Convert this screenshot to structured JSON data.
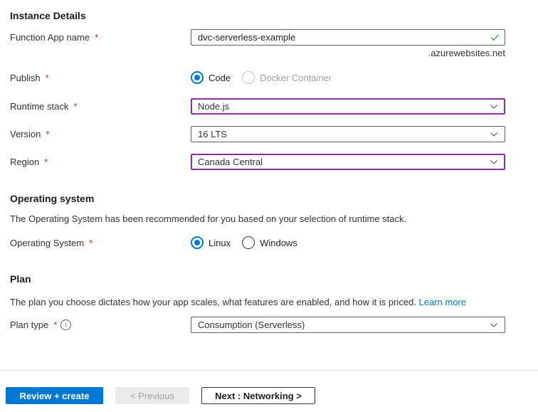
{
  "ui": {
    "required_mark": "*",
    "info_glyph": "i"
  },
  "colors": {
    "accent": "#0078d4",
    "dirty": "#8a2da5",
    "required": "#bc2f32",
    "valid": "#5ba05b"
  },
  "instance_details": {
    "title": "Instance Details",
    "function_app_name": {
      "label": "Function App name",
      "value": "dvc-serverless-example",
      "suffix": ".azurewebsites.net",
      "valid": true
    },
    "publish": {
      "label": "Publish",
      "options": [
        {
          "label": "Code",
          "selected": true,
          "disabled": false
        },
        {
          "label": "Docker Container",
          "selected": false,
          "disabled": true
        }
      ]
    },
    "runtime_stack": {
      "label": "Runtime stack",
      "value": "Node.js",
      "modified": true
    },
    "version": {
      "label": "Version",
      "value": "16 LTS",
      "modified": false
    },
    "region": {
      "label": "Region",
      "value": "Canada Central",
      "modified": true
    }
  },
  "operating_system": {
    "title": "Operating system",
    "description": "The Operating System has been recommended for you based on your selection of runtime stack.",
    "field": {
      "label": "Operating System",
      "options": [
        {
          "label": "Linux",
          "selected": true,
          "disabled": false
        },
        {
          "label": "Windows",
          "selected": false,
          "disabled": false
        }
      ]
    }
  },
  "plan": {
    "title": "Plan",
    "description": "The plan you choose dictates how your app scales, what features are enabled, and how it is priced.",
    "learn_more_label": "Learn more",
    "plan_type": {
      "label": "Plan type",
      "value": "Consumption (Serverless)",
      "modified": false
    }
  },
  "footer": {
    "review_create_label": "Review + create",
    "previous_label": "< Previous",
    "next_label": "Next : Networking >"
  }
}
